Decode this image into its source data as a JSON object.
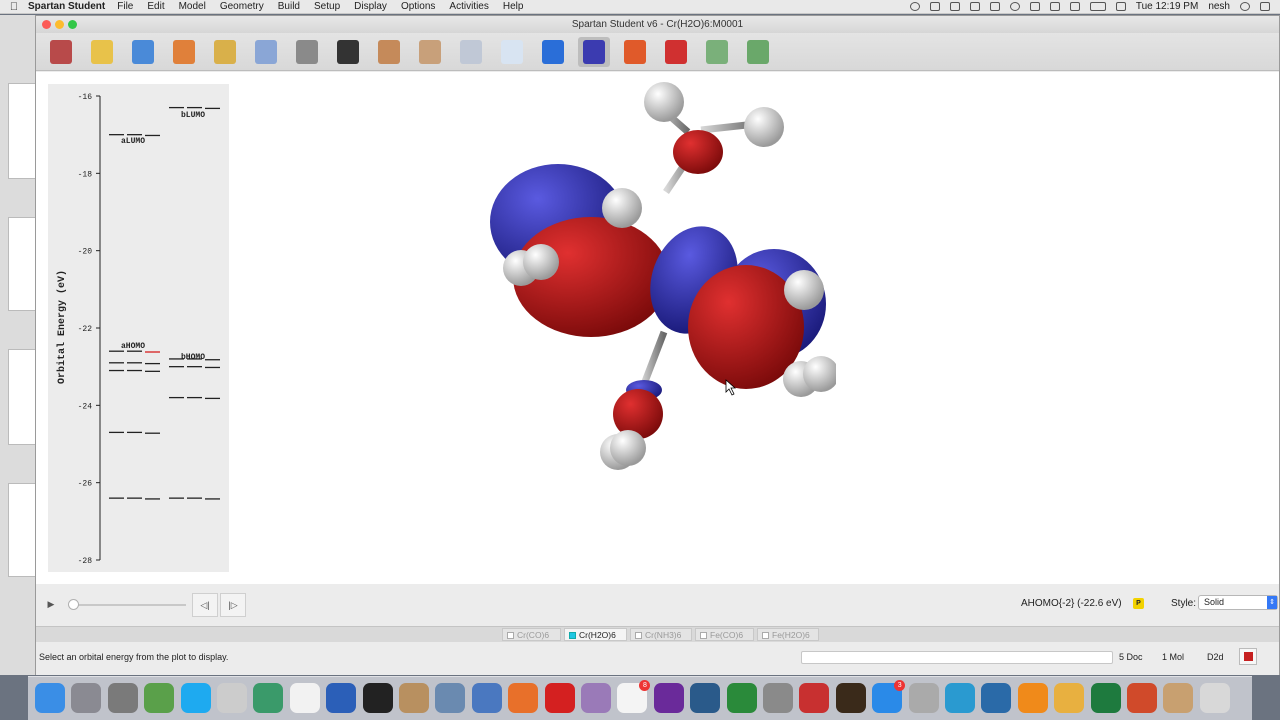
{
  "menubar": {
    "app_name": "Spartan Student",
    "menus": [
      "File",
      "Edit",
      "Model",
      "Geometry",
      "Build",
      "Setup",
      "Display",
      "Options",
      "Activities",
      "Help"
    ],
    "clock": "Tue 12:19 PM",
    "user": "nesh"
  },
  "window": {
    "title": "Spartan Student v6 - Cr(H2O)6:M0001"
  },
  "toolbar": {
    "tools": [
      {
        "name": "new-molecule",
        "color": "#b84a4a"
      },
      {
        "name": "edit-notes",
        "color": "#e8c24a"
      },
      {
        "name": "open-folder",
        "color": "#4a8ad8"
      },
      {
        "name": "open-recent",
        "color": "#e0803a"
      },
      {
        "name": "save",
        "color": "#d9b04a"
      },
      {
        "name": "undo",
        "color": "#8aa6d6"
      },
      {
        "name": "build-tools",
        "color": "#8a8a8a"
      },
      {
        "name": "view-glasses",
        "color": "#333333"
      },
      {
        "name": "setup-calculation",
        "color": "#c58a5a"
      },
      {
        "name": "submit-calculation",
        "color": "#c8a07a"
      },
      {
        "name": "monitor",
        "color": "#c0c8d6"
      },
      {
        "name": "output",
        "color": "#d8e4f2"
      },
      {
        "name": "info",
        "color": "#2a6ed8"
      },
      {
        "name": "surfaces",
        "color": "#3b3bb0"
      },
      {
        "name": "electrostatic-map",
        "color": "#e05a2a"
      },
      {
        "name": "spectra",
        "color": "#d03030"
      },
      {
        "name": "spreadsheet",
        "color": "#7ab07a"
      },
      {
        "name": "plots",
        "color": "#6aa86a"
      }
    ],
    "active_index": 13
  },
  "energy_plot": {
    "axis_label": "Orbital Energy (eV)",
    "ticks": [
      "-16",
      "-18",
      "-20",
      "-22",
      "-24",
      "-26",
      "-28"
    ],
    "alpha_label_lumo": "aLUMO",
    "alpha_label_homo": "aHOMO",
    "beta_label_lumo": "bLUMO",
    "beta_label_homo": "bHOMO",
    "ylim": [
      -28,
      -16
    ],
    "alpha_levels": [
      -17.0,
      -22.6,
      -22.9,
      -23.1,
      -24.7,
      -26.4
    ],
    "beta_levels": [
      -16.3,
      -22.8,
      -23.0,
      -23.8,
      -26.4
    ],
    "selected_color": "#d62020"
  },
  "playback": {
    "play": "▶",
    "prev": "◁|",
    "next": "|▷",
    "orbital_label": "AHOMO{-2} (-22.6 eV)",
    "badge": "P",
    "style_label": "Style:",
    "style_value": "Solid"
  },
  "tabs": [
    "Cr(CO)6",
    "Cr(H2O)6",
    "Cr(NH3)6",
    "Fe(CO)6",
    "Fe(H2O)6"
  ],
  "active_tab": 1,
  "status": {
    "message": "Select an orbital energy from the plot to display.",
    "doc": "5 Doc",
    "mol": "1 Mol",
    "sym": "D2d"
  },
  "dock": {
    "icons": [
      {
        "name": "finder",
        "color": "#3a8ee6"
      },
      {
        "name": "launchpad",
        "color": "#8a8a92"
      },
      {
        "name": "system-preferences",
        "color": "#7a7a7a"
      },
      {
        "name": "molecule-app",
        "color": "#5aa04a"
      },
      {
        "name": "skype",
        "color": "#1eaaf0"
      },
      {
        "name": "scissors-app",
        "color": "#cccccc"
      },
      {
        "name": "browser-globe",
        "color": "#3a9a6a"
      },
      {
        "name": "notes-pad",
        "color": "#f2f2f2"
      },
      {
        "name": "word",
        "color": "#2b5fb8"
      },
      {
        "name": "terminal",
        "color": "#222222"
      },
      {
        "name": "contacts",
        "color": "#b89060"
      },
      {
        "name": "preview",
        "color": "#6a8ab0"
      },
      {
        "name": "photo-app",
        "color": "#4a78c0"
      },
      {
        "name": "firefox",
        "color": "#e8702a"
      },
      {
        "name": "acrobat",
        "color": "#d42020"
      },
      {
        "name": "archive-utility",
        "color": "#9a7ab8"
      },
      {
        "name": "calendar",
        "color": "#f4f4f4",
        "badge": "8"
      },
      {
        "name": "github",
        "color": "#6a2a9a"
      },
      {
        "name": "tree-app",
        "color": "#2a5a8a"
      },
      {
        "name": "green-app",
        "color": "#2a8a3a"
      },
      {
        "name": "stethoscope-app",
        "color": "#8a8a8a"
      },
      {
        "name": "molecule-viewer",
        "color": "#c83030"
      },
      {
        "name": "amber-app",
        "color": "#3a2a1a"
      },
      {
        "name": "app-store",
        "color": "#2a8ae8",
        "badge": "3"
      },
      {
        "name": "scanner",
        "color": "#aaaaaa"
      },
      {
        "name": "s-app",
        "color": "#2a9ad0"
      },
      {
        "name": "quicktime",
        "color": "#2a6aa8"
      },
      {
        "name": "vlc",
        "color": "#f08a1a"
      },
      {
        "name": "photos",
        "color": "#e8b040"
      },
      {
        "name": "excel",
        "color": "#1e7a3e"
      },
      {
        "name": "powerpoint",
        "color": "#d04a2a"
      },
      {
        "name": "spartan",
        "color": "#c8a070"
      },
      {
        "name": "trash",
        "color": "#d8d8d8"
      }
    ]
  }
}
